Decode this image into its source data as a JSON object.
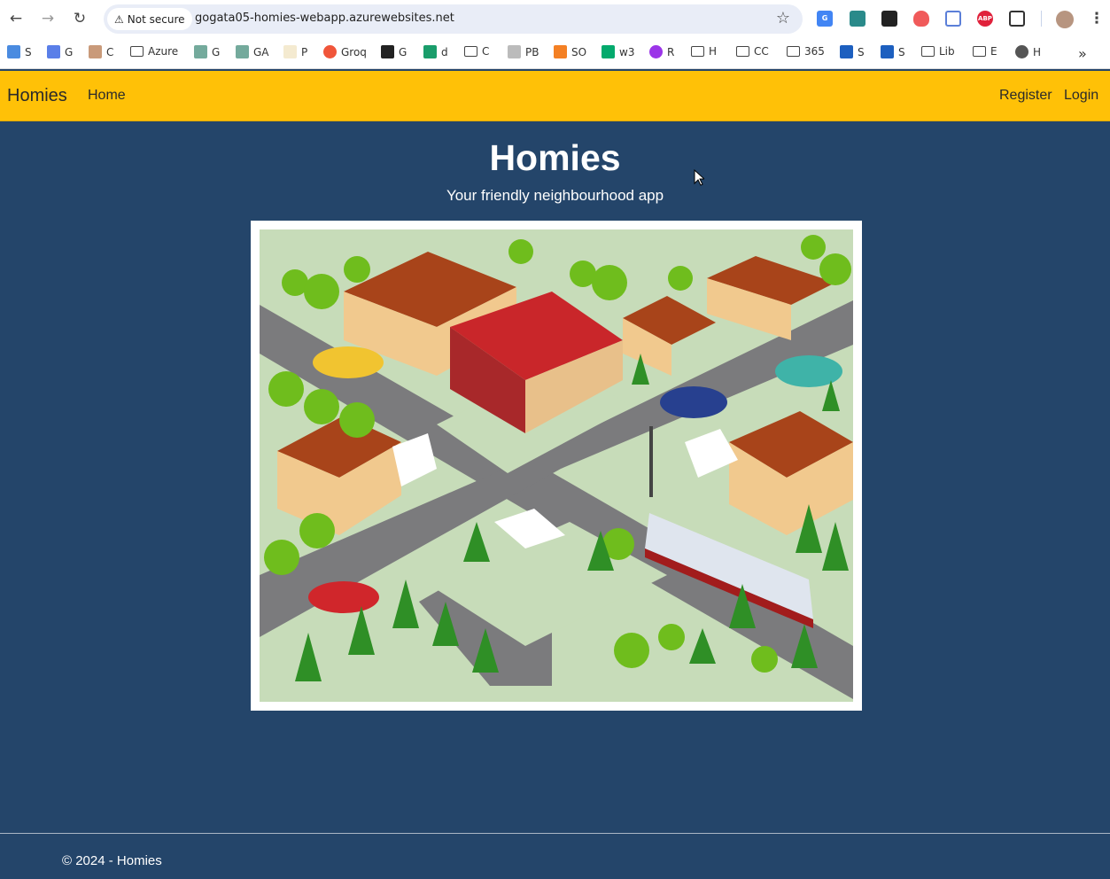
{
  "browser": {
    "security_label": "Not secure",
    "url": "gogata05-homies-webapp.azurewebsites.net",
    "bookmarks": [
      {
        "label": "S",
        "icon": "plane-icon"
      },
      {
        "label": "G",
        "icon": "gemini-icon"
      },
      {
        "label": "C",
        "icon": "anthropic-icon"
      },
      {
        "label": "Azure",
        "icon": "folder-icon"
      },
      {
        "label": "G",
        "icon": "openai-icon"
      },
      {
        "label": "GA",
        "icon": "openai-icon"
      },
      {
        "label": "P",
        "icon": "pi-icon"
      },
      {
        "label": "Groq",
        "icon": "groq-icon"
      },
      {
        "label": "G",
        "icon": "github-icon"
      },
      {
        "label": "d",
        "icon": "d-icon"
      },
      {
        "label": "C",
        "icon": "folder-icon"
      },
      {
        "label": "PB",
        "icon": "binary-icon"
      },
      {
        "label": "SO",
        "icon": "stackoverflow-icon"
      },
      {
        "label": "w3",
        "icon": "w3schools-icon"
      },
      {
        "label": "R",
        "icon": "u-icon"
      },
      {
        "label": "H",
        "icon": "folder-icon"
      },
      {
        "label": "CC",
        "icon": "folder-icon"
      },
      {
        "label": "365",
        "icon": "folder-icon"
      },
      {
        "label": "S",
        "icon": "shield-icon"
      },
      {
        "label": "S",
        "icon": "shield-icon"
      },
      {
        "label": "Lib",
        "icon": "folder-icon"
      },
      {
        "label": "E",
        "icon": "folder-icon"
      },
      {
        "label": "H",
        "icon": "globe-icon"
      }
    ],
    "extensions": [
      "google-translate-icon",
      "extension-icon",
      "extension-icon",
      "shield-icon",
      "grid-icon",
      "adblock-icon",
      "puzzle-icon"
    ],
    "adblock_label": "ABP"
  },
  "navbar": {
    "brand": "Homies",
    "home": "Home",
    "register": "Register",
    "login": "Login"
  },
  "hero": {
    "title": "Homies",
    "subtitle": "Your friendly neighbourhood app"
  },
  "footer": {
    "text": "© 2024 - Homies"
  },
  "colors": {
    "navbar": "#ffc107",
    "background": "#24456a"
  }
}
